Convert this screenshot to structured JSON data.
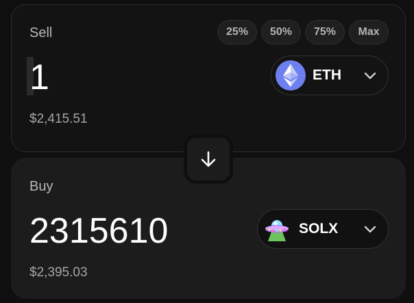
{
  "sell": {
    "label": "Sell",
    "amount": "1",
    "usd_value": "$2,415.51",
    "percent_buttons": [
      "25%",
      "50%",
      "75%",
      "Max"
    ],
    "token": {
      "symbol": "ETH",
      "icon": "ethereum-icon",
      "icon_color": "#6e7ff0"
    }
  },
  "swap": {
    "icon": "arrow-down-icon"
  },
  "buy": {
    "label": "Buy",
    "amount": "2315610",
    "usd_value": "$2,395.03",
    "token": {
      "symbol": "SOLX",
      "icon": "ufo-icon"
    }
  },
  "colors": {
    "page_bg": "#0f0f0f",
    "sell_card_bg": "#131313",
    "buy_card_bg": "#1c1c1c",
    "label_text": "#b8b8b8",
    "secondary_text": "#a6a6a6"
  }
}
